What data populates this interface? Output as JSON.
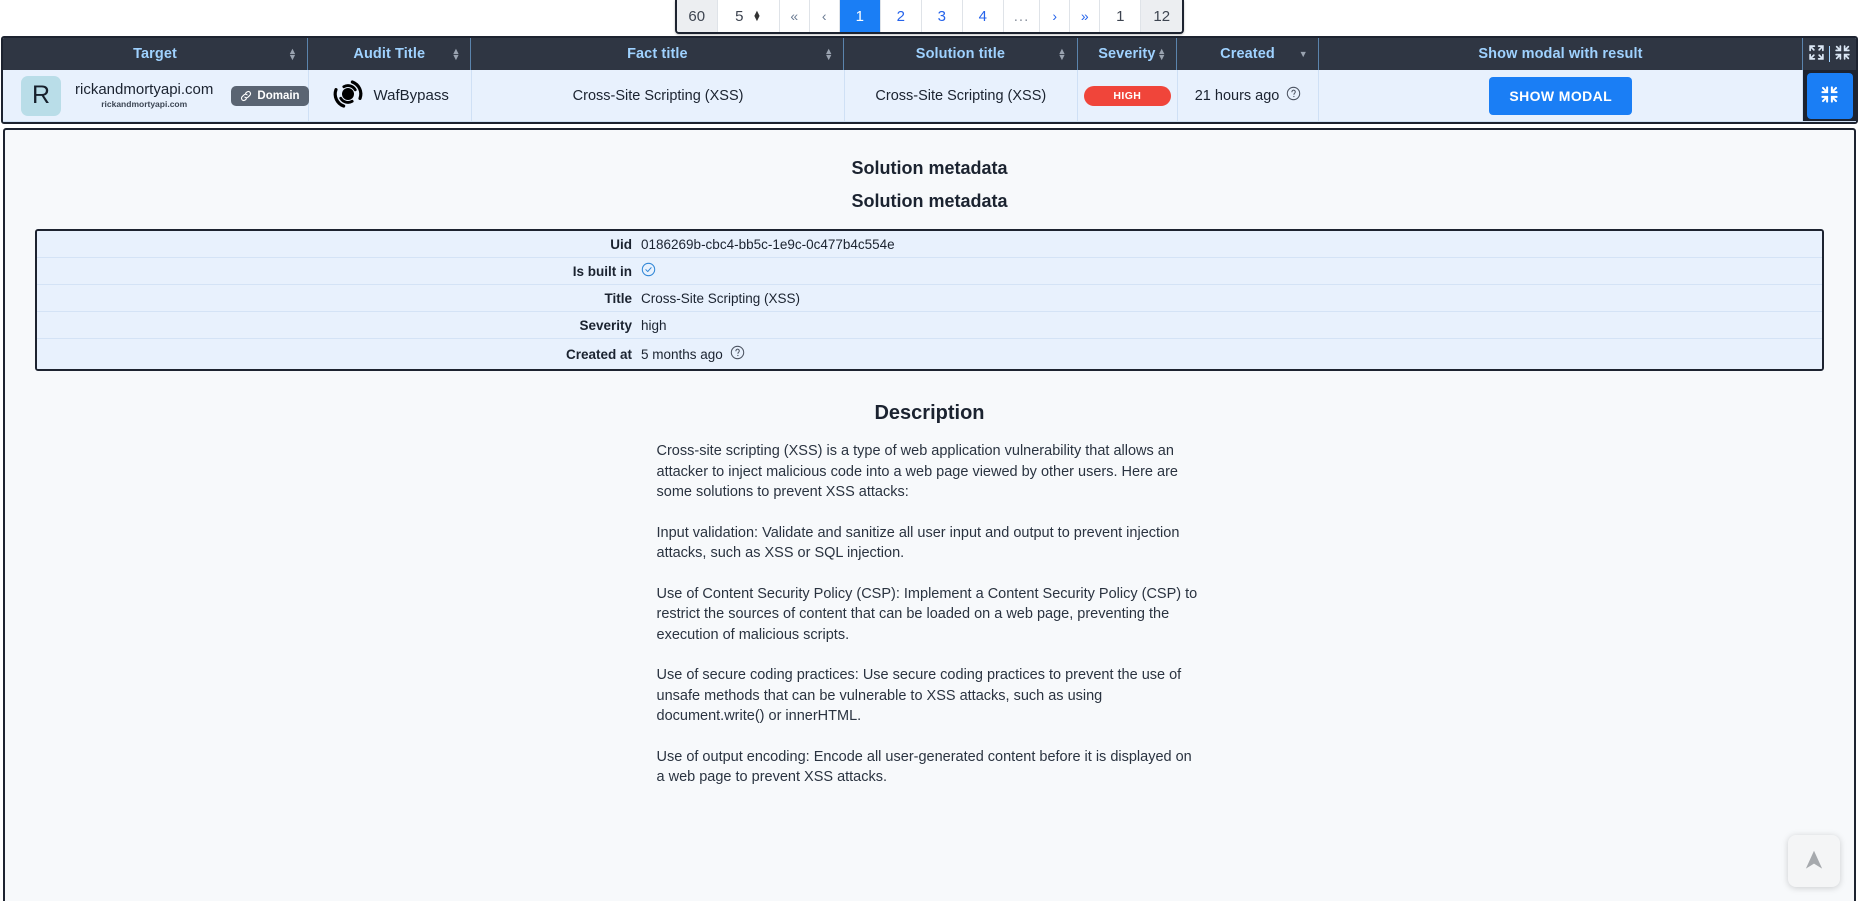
{
  "pagination": {
    "total_label": "60",
    "page_size": "5",
    "first_label": "«",
    "prev_label": "‹",
    "pages": [
      "1",
      "2",
      "3",
      "4"
    ],
    "ellipsis": "...",
    "next_label": "›",
    "last_label": "»",
    "current_page": "1",
    "total_pages": "12"
  },
  "table": {
    "columns": [
      {
        "label": "Target",
        "sorted": "none"
      },
      {
        "label": "Audit Title",
        "sorted": "none"
      },
      {
        "label": "Fact title",
        "sorted": "none"
      },
      {
        "label": "Solution title",
        "sorted": "none"
      },
      {
        "label": "Severity",
        "sorted": "none"
      },
      {
        "label": "Created",
        "sorted": "desc"
      },
      {
        "label": "Show modal with result",
        "sorted": "none"
      }
    ],
    "expand_all_icon": "expand-all-icon",
    "collapse_all_icon": "collapse-all-icon",
    "row": {
      "avatar_letter": "R",
      "target_name": "rickandmortyapi.com",
      "target_sub": "rickandmortyapi.com",
      "target_chip": "Domain",
      "target_chip_icon": "link-icon",
      "audit_icon": "wafbypass-icon",
      "audit_title": "WafBypass",
      "fact_title": "Cross-Site Scripting (XSS)",
      "solution_title": "Cross-Site Scripting (XSS)",
      "severity": "HIGH",
      "created": "21 hours ago",
      "created_help_icon": "question-circle-icon",
      "show_modal_label": "SHOW MODAL",
      "collapse_row_icon": "collapse-icon"
    }
  },
  "detail": {
    "title": "Solution metadata",
    "subtitle": "Solution metadata",
    "metadata": [
      {
        "key": "Uid",
        "value": "0186269b-cbc4-bb5c-1e9c-0c477b4c554e",
        "type": "text"
      },
      {
        "key": "Is built in",
        "value": "",
        "type": "check"
      },
      {
        "key": "Title",
        "value": "Cross-Site Scripting (XSS)",
        "type": "text"
      },
      {
        "key": "Severity",
        "value": "high",
        "type": "text"
      },
      {
        "key": "Created at",
        "value": "5 months ago",
        "type": "text-help"
      }
    ],
    "description_heading": "Description",
    "description_paragraphs": [
      "Cross-site scripting (XSS) is a type of web application vulnerability that allows an attacker to inject malicious code into a web page viewed by other users. Here are some solutions to prevent XSS attacks:",
      "Input validation: Validate and sanitize all user input and output to prevent injection attacks, such as XSS or SQL injection.",
      "Use of Content Security Policy (CSP): Implement a Content Security Policy (CSP) to restrict the sources of content that can be loaded on a web page, preventing the execution of malicious scripts.",
      "Use of secure coding practices: Use secure coding practices to prevent the use of unsafe methods that can be vulnerable to XSS attacks, such as using document.write() or innerHTML.",
      "Use of output encoding: Encode all user-generated content before it is displayed on a web page to prevent XSS attacks."
    ],
    "scroll_top_icon": "arrow-up-icon"
  },
  "colors": {
    "header_bg": "#2f3643",
    "header_text": "#9fd2ff",
    "row_bg": "#e8f1fd",
    "accent": "#1a7ef5",
    "severity_high": "#f0453a",
    "avatar_bg": "#b9dde8"
  }
}
